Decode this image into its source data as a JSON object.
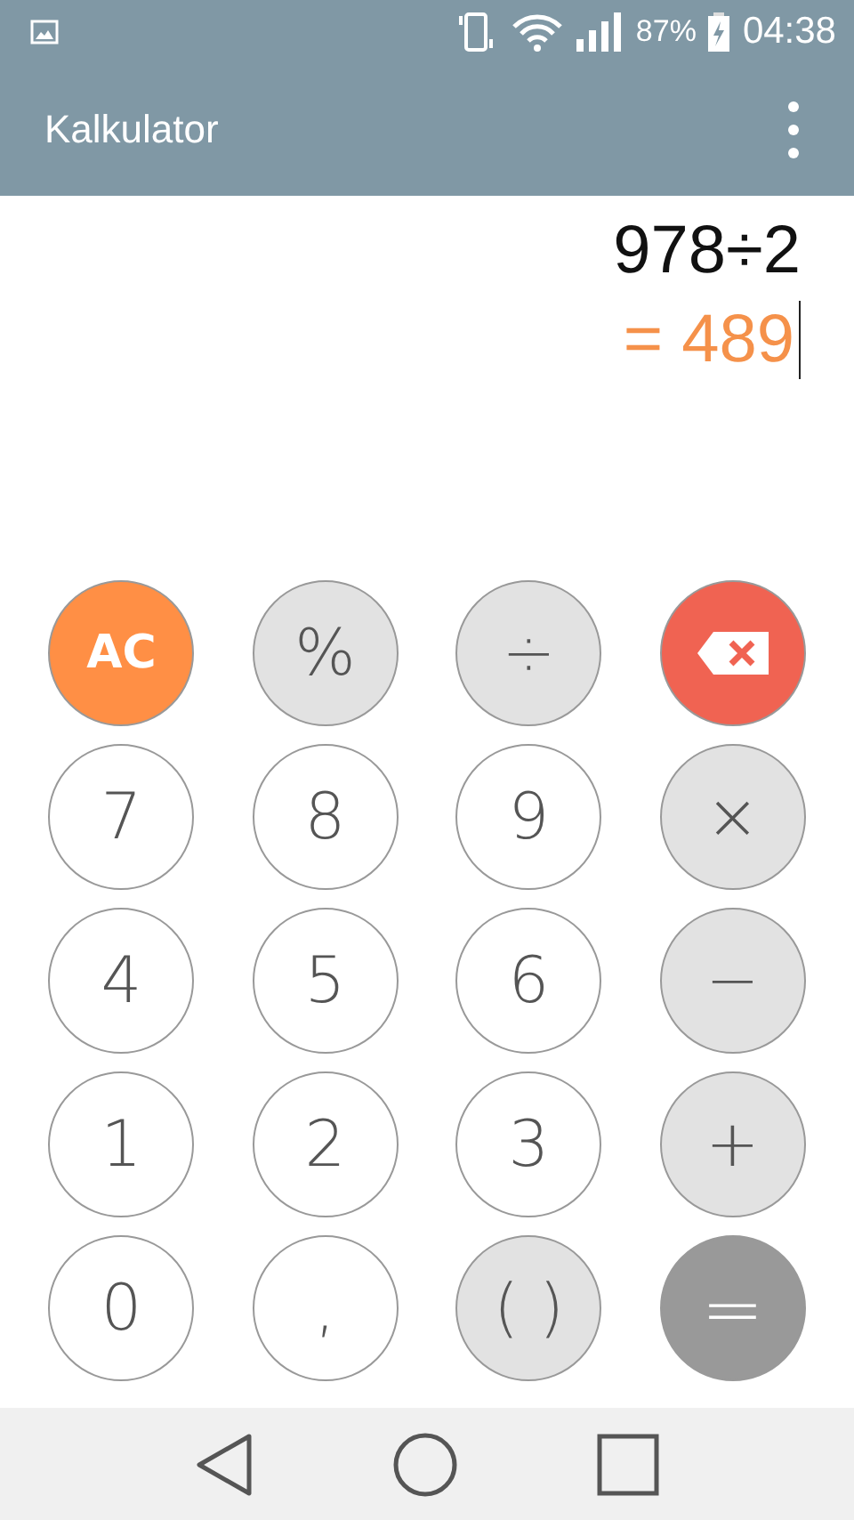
{
  "status_bar": {
    "battery": "87%",
    "time": "04:38"
  },
  "app_bar": {
    "title": "Kalkulator"
  },
  "display": {
    "expression": "978÷2",
    "result": "= 489"
  },
  "keys": [
    {
      "kind": "clear",
      "label": "AC"
    },
    {
      "kind": "function",
      "label": "%"
    },
    {
      "kind": "function",
      "label": "÷"
    },
    {
      "kind": "backspace"
    },
    {
      "kind": "digit",
      "label": "7"
    },
    {
      "kind": "digit",
      "label": "8"
    },
    {
      "kind": "digit",
      "label": "9"
    },
    {
      "kind": "function",
      "label": "×"
    },
    {
      "kind": "digit",
      "label": "4"
    },
    {
      "kind": "digit",
      "label": "5"
    },
    {
      "kind": "digit",
      "label": "6"
    },
    {
      "kind": "function",
      "label": "−"
    },
    {
      "kind": "digit",
      "label": "1"
    },
    {
      "kind": "digit",
      "label": "2"
    },
    {
      "kind": "digit",
      "label": "3"
    },
    {
      "kind": "function",
      "label": "+"
    },
    {
      "kind": "digit",
      "label": "0"
    },
    {
      "kind": "digit",
      "label": ","
    },
    {
      "kind": "function",
      "label": "( )"
    },
    {
      "kind": "equals",
      "label": "="
    }
  ]
}
